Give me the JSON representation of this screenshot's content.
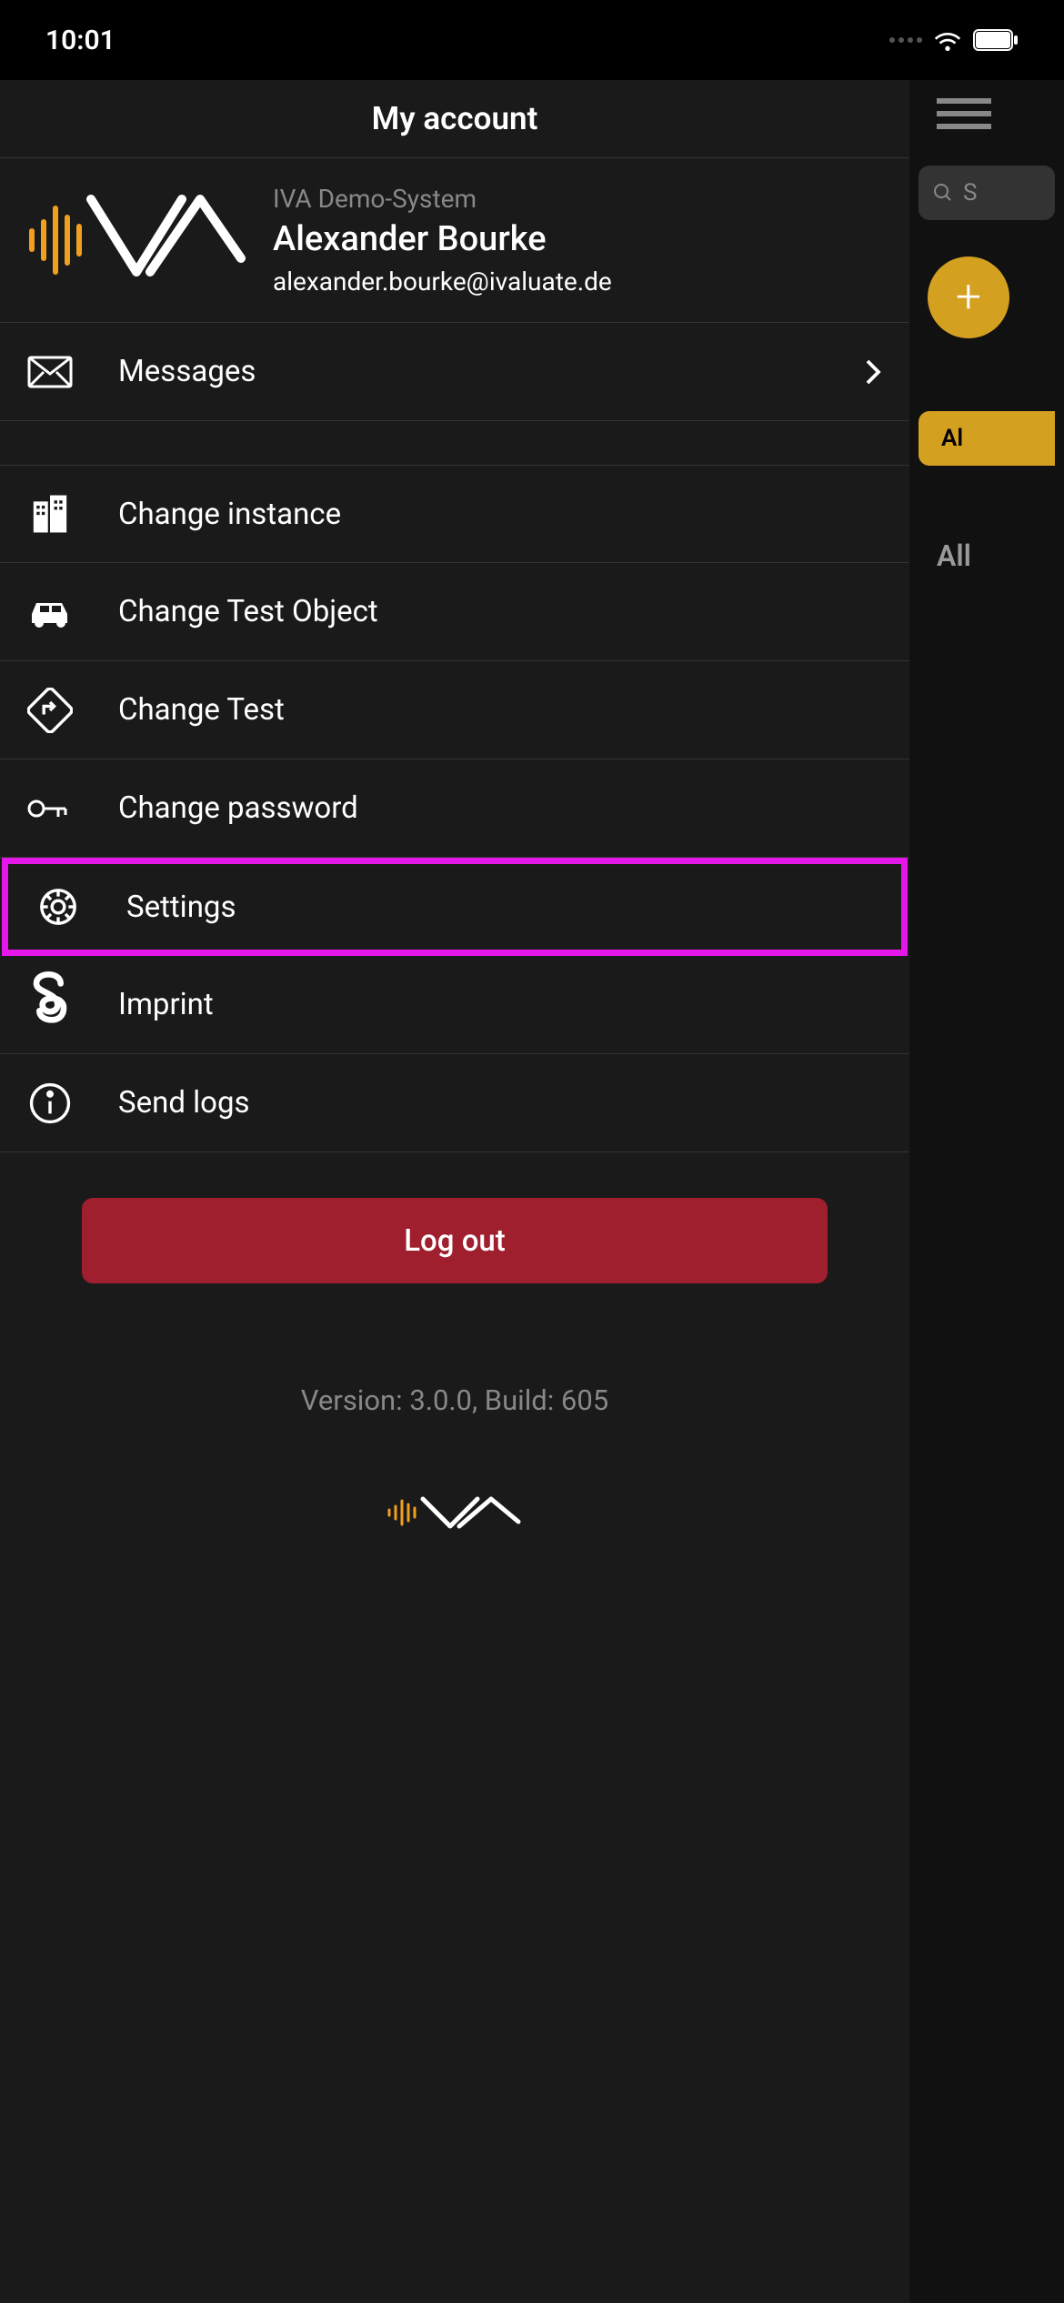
{
  "statusBar": {
    "time": "10:01"
  },
  "panel": {
    "title": "My account"
  },
  "user": {
    "systemName": "IVA Demo-System",
    "name": "Alexander Bourke",
    "email": "alexander.bourke@ivaluate.de"
  },
  "menu": {
    "messages": "Messages",
    "changeInstance": "Change instance",
    "changeTestObject": "Change Test Object",
    "changeTest": "Change Test",
    "changePassword": "Change password",
    "settings": "Settings",
    "imprint": "Imprint",
    "sendLogs": "Send logs"
  },
  "logoutLabel": "Log out",
  "version": "Version: 3.0.0, Build: 605",
  "background": {
    "searchPlaceholder": "S",
    "allButton": "Al",
    "allText": "All"
  }
}
